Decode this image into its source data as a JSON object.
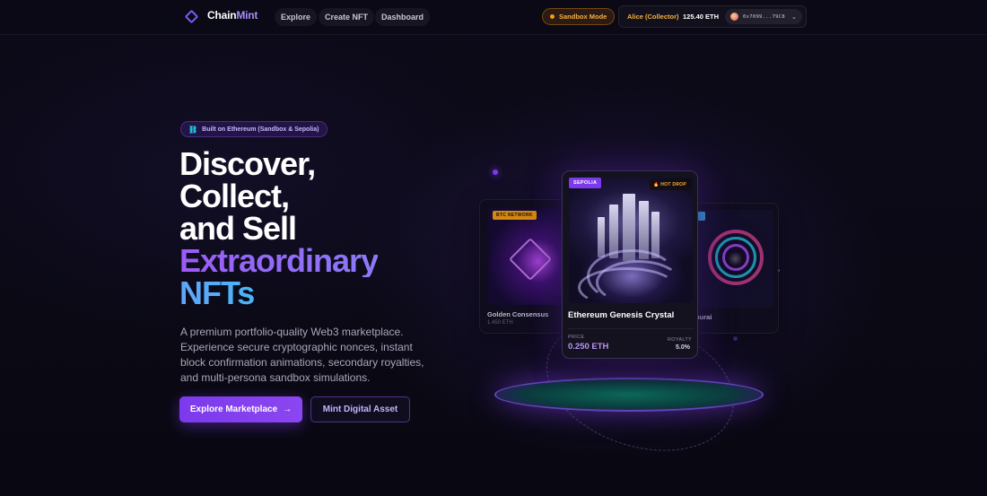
{
  "brand": {
    "name_part1": "Chain",
    "name_part2": "Mint"
  },
  "nav": {
    "links": [
      {
        "label": "Explore"
      },
      {
        "label": "Create NFT"
      },
      {
        "label": "Dashboard"
      }
    ],
    "sandbox_label": "Sandbox Mode",
    "account": {
      "name": "Alice (Collector)",
      "balance": "125.40 ETH",
      "address": "0x7099...79C8"
    }
  },
  "hero": {
    "badge": "Built on Ethereum (Sandbox & Sepolia)",
    "headline": [
      "Discover,",
      "Collect,",
      "and Sell"
    ],
    "headline_accent1": "Extraordinary",
    "headline_accent2": "NFTs",
    "description": "A premium portfolio-quality Web3 marketplace. Experience secure cryptographic nonces, instant block confirmation animations, secondary royalties, and multi-persona sandbox simulations.",
    "primary_button": "Explore Marketplace",
    "primary_button_icon": "→",
    "secondary_button": "Mint Digital Asset"
  },
  "cards": {
    "left": {
      "tag": "BTC NETWORK",
      "title": "Golden Consensus",
      "price": "1.450 ETH"
    },
    "right": {
      "title": "murai"
    },
    "main": {
      "network": "SEPOLIA",
      "hot": "🔥 HOT DROP",
      "title": "Ethereum Genesis Crystal",
      "price_label": "PRICE",
      "price": "0.250 ETH",
      "royalty_label": "ROYALTY",
      "royalty": "5.0%"
    }
  },
  "colors": {
    "accent": "#7c3aed",
    "accent_light": "#a78bfa",
    "sandbox": "#f59e0b",
    "cyan": "#22d3ee",
    "background": "#0a0914"
  }
}
